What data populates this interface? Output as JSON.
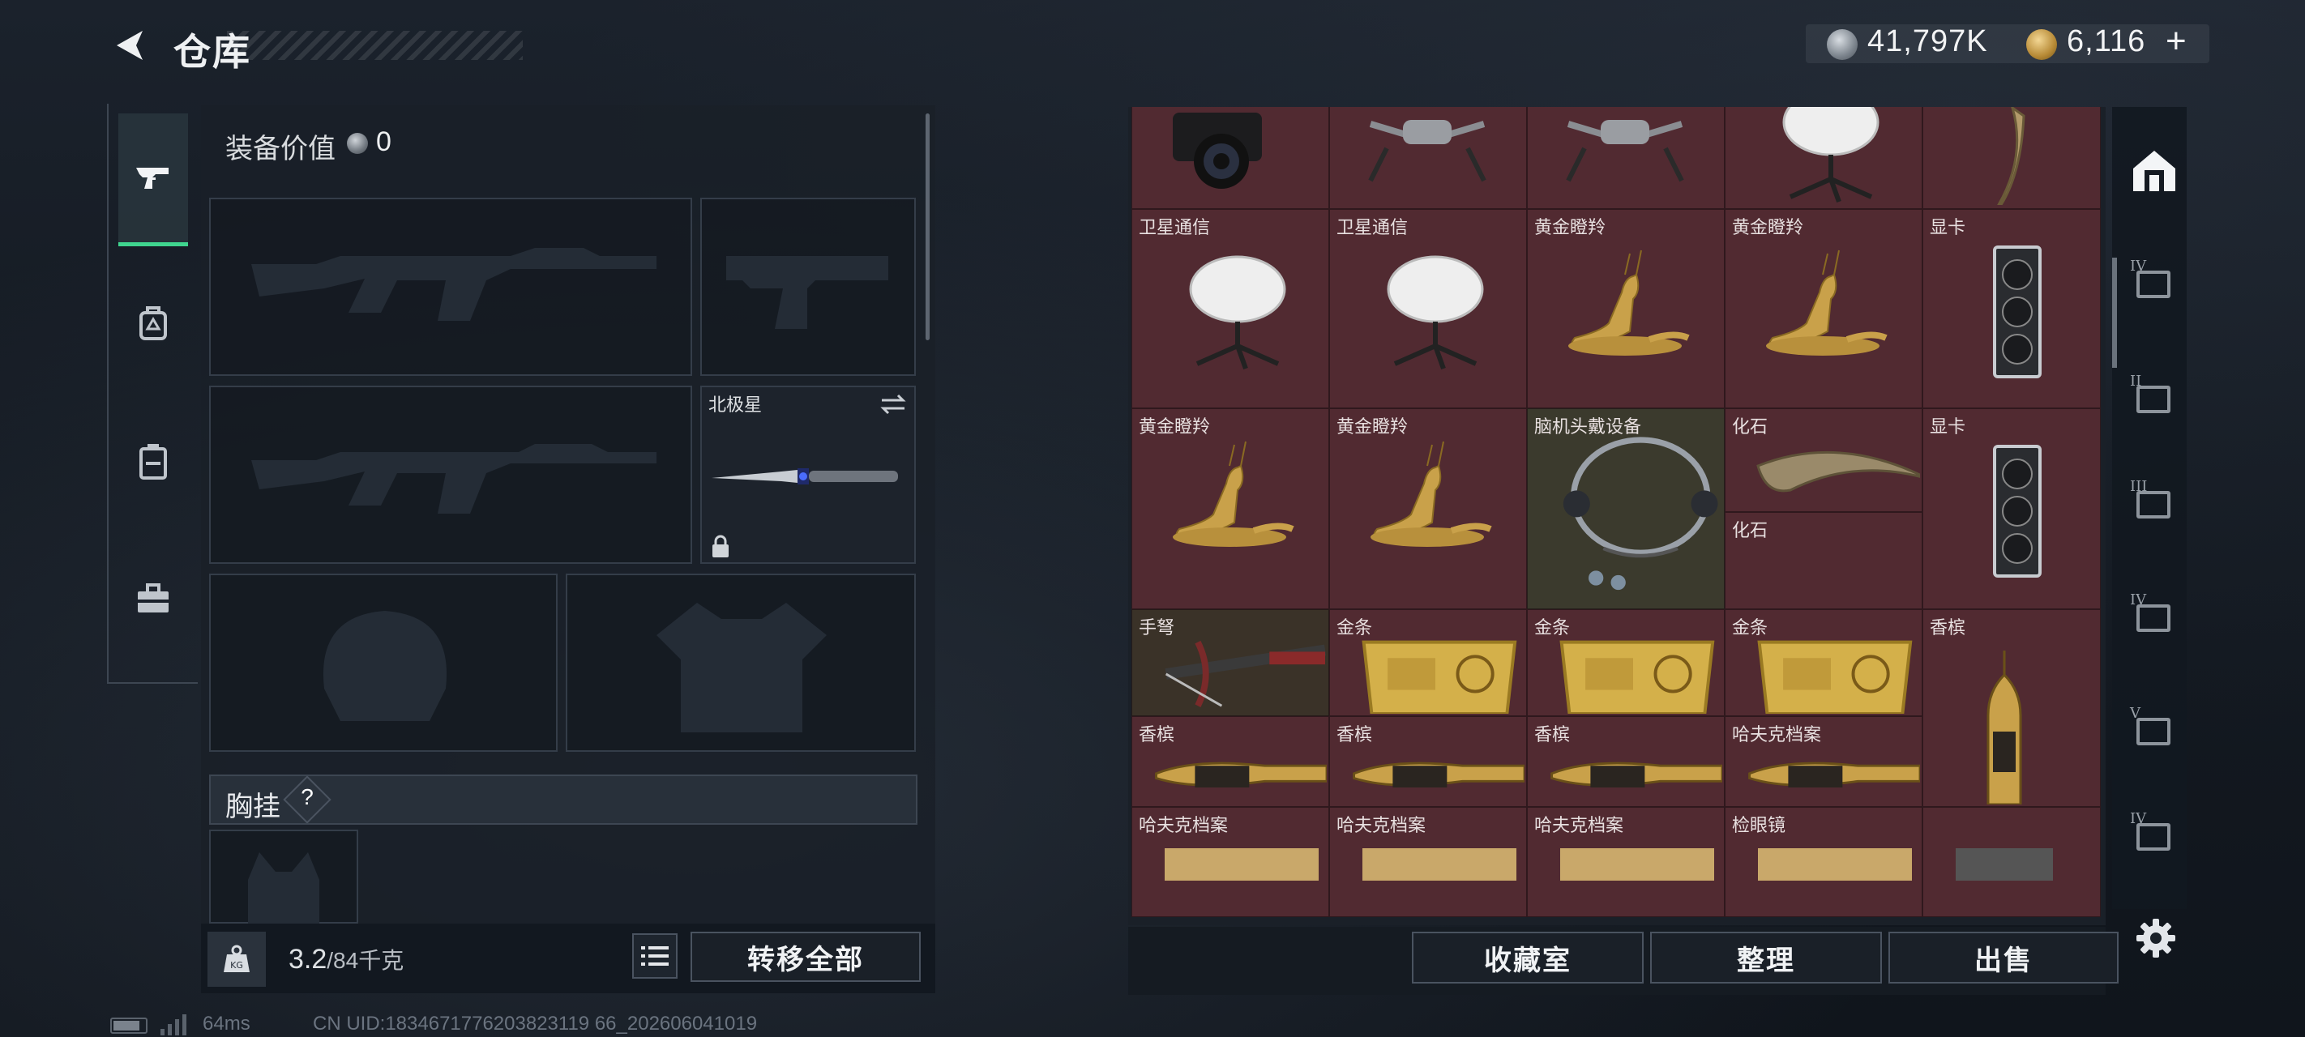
{
  "header": {
    "title": "仓库",
    "silver_amount": "41,797K",
    "gold_amount": "6,116",
    "gold_plus": "+"
  },
  "left_tabs": [
    "pistol-icon",
    "backpack-icon",
    "case-icon",
    "toolbox-icon"
  ],
  "equipment": {
    "value_label": "装备价值",
    "value": "0",
    "melee_name": "北极星",
    "chest_label": "胸挂",
    "help": "?"
  },
  "bottom": {
    "weight_value": "3.2",
    "weight_total": "/84千克",
    "transfer_all": "转移全部",
    "kg_badge": "KG"
  },
  "grid_items": [
    {
      "name": "",
      "art": "camera"
    },
    {
      "name": "",
      "art": "drone"
    },
    {
      "name": "",
      "art": "drone"
    },
    {
      "name": "",
      "art": "dish"
    },
    {
      "name": "",
      "art": "fang"
    },
    {
      "name": "卫星通信",
      "art": "dish"
    },
    {
      "name": "卫星通信",
      "art": "dish"
    },
    {
      "name": "黄金瞪羚",
      "art": "gazelle"
    },
    {
      "name": "黄金瞪羚",
      "art": "gazelle"
    },
    {
      "name": "显卡",
      "art": "gpu"
    },
    {
      "name": "黄金瞪羚",
      "art": "gazelle"
    },
    {
      "name": "黄金瞪羚",
      "art": "gazelle"
    },
    {
      "name": "脑机头戴设备",
      "art": "headset"
    },
    {
      "name": "化石",
      "art": "fossil"
    },
    {
      "name": "化石",
      "art": "fossil"
    },
    {
      "name": "显卡",
      "art": "gpu"
    },
    {
      "name": "手弩",
      "art": "crossbow"
    },
    {
      "name": "金条",
      "art": "goldbar"
    },
    {
      "name": "金条",
      "art": "goldbar"
    },
    {
      "name": "金条",
      "art": "goldbar"
    },
    {
      "name": "香槟",
      "art": "champagne"
    },
    {
      "name": "香槟",
      "art": "champagne"
    },
    {
      "name": "香槟",
      "art": "champagne"
    },
    {
      "name": "香槟",
      "art": "champagne"
    },
    {
      "name": "哈夫克档案",
      "art": "file"
    },
    {
      "name": "哈夫克档案",
      "art": "file"
    },
    {
      "name": "哈夫克档案",
      "art": "file"
    },
    {
      "name": "哈夫克档案",
      "art": "file"
    },
    {
      "name": "检眼镜",
      "art": "scope"
    }
  ],
  "buttons": {
    "collection": "收藏室",
    "organize": "整理",
    "sell": "出售"
  },
  "right_rail": [
    "vault-icon",
    "IV",
    "II",
    "III",
    "IV",
    "V",
    "IV"
  ],
  "status": {
    "ping": "64ms",
    "uid": "CN UID:1834671776203823119 66_202606041019"
  },
  "colors": {
    "accent_green": "#3fd58f",
    "cell_red": "#512a31",
    "gold": "#c9a14a"
  }
}
